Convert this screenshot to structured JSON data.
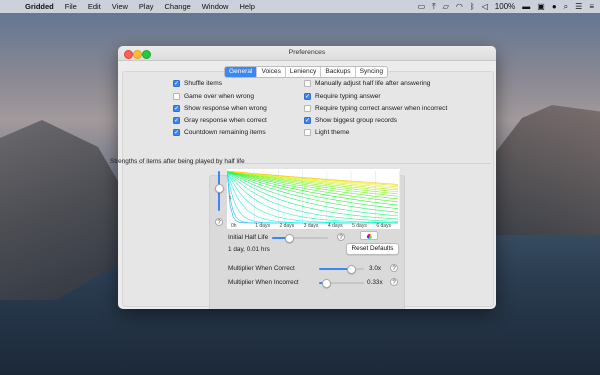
{
  "menubar": {
    "app_name": "Gridded",
    "items": [
      "File",
      "Edit",
      "View",
      "Play",
      "Change",
      "Window",
      "Help"
    ],
    "battery": "100%"
  },
  "window": {
    "title": "Preferences",
    "tabs": [
      {
        "label": "General",
        "active": true
      },
      {
        "label": "Voices",
        "active": false
      },
      {
        "label": "Leniency",
        "active": false
      },
      {
        "label": "Backups",
        "active": false
      },
      {
        "label": "Syncing",
        "active": false
      }
    ]
  },
  "options_left": [
    {
      "label": "Shuffle items",
      "checked": true
    },
    {
      "label": "Game over when wrong",
      "checked": false
    },
    {
      "label": "Show response when wrong",
      "checked": true
    },
    {
      "label": "Gray response when correct",
      "checked": true
    },
    {
      "label": "Countdown remaining items",
      "checked": true
    }
  ],
  "options_right": [
    {
      "label": "Manually adjust half life after answering",
      "checked": false
    },
    {
      "label": "Require typing answer",
      "checked": true
    },
    {
      "label": "Require typing correct answer when incorrect",
      "checked": false
    },
    {
      "label": "Show biggest group records",
      "checked": true
    },
    {
      "label": "Light theme",
      "checked": false
    }
  ],
  "graph": {
    "title": "Strengths of items after being played by half life",
    "x_tick_labels": [
      "0h",
      "1 days",
      "2 days",
      "3 days",
      "4 days",
      "5 days",
      "6 days"
    ],
    "y_label": "1"
  },
  "half_life": {
    "label": "Initial Half Life",
    "value_text": "1 day, 0.01 hrs",
    "slider_fraction": 0.3,
    "reset_label": "Reset Defaults"
  },
  "multipliers": [
    {
      "label": "Multiplier When Correct",
      "value_text": "3.0x",
      "slider_fraction": 0.7
    },
    {
      "label": "Multiplier When Incorrect",
      "value_text": "0.33x",
      "slider_fraction": 0.15
    }
  ],
  "help_glyph": "?"
}
